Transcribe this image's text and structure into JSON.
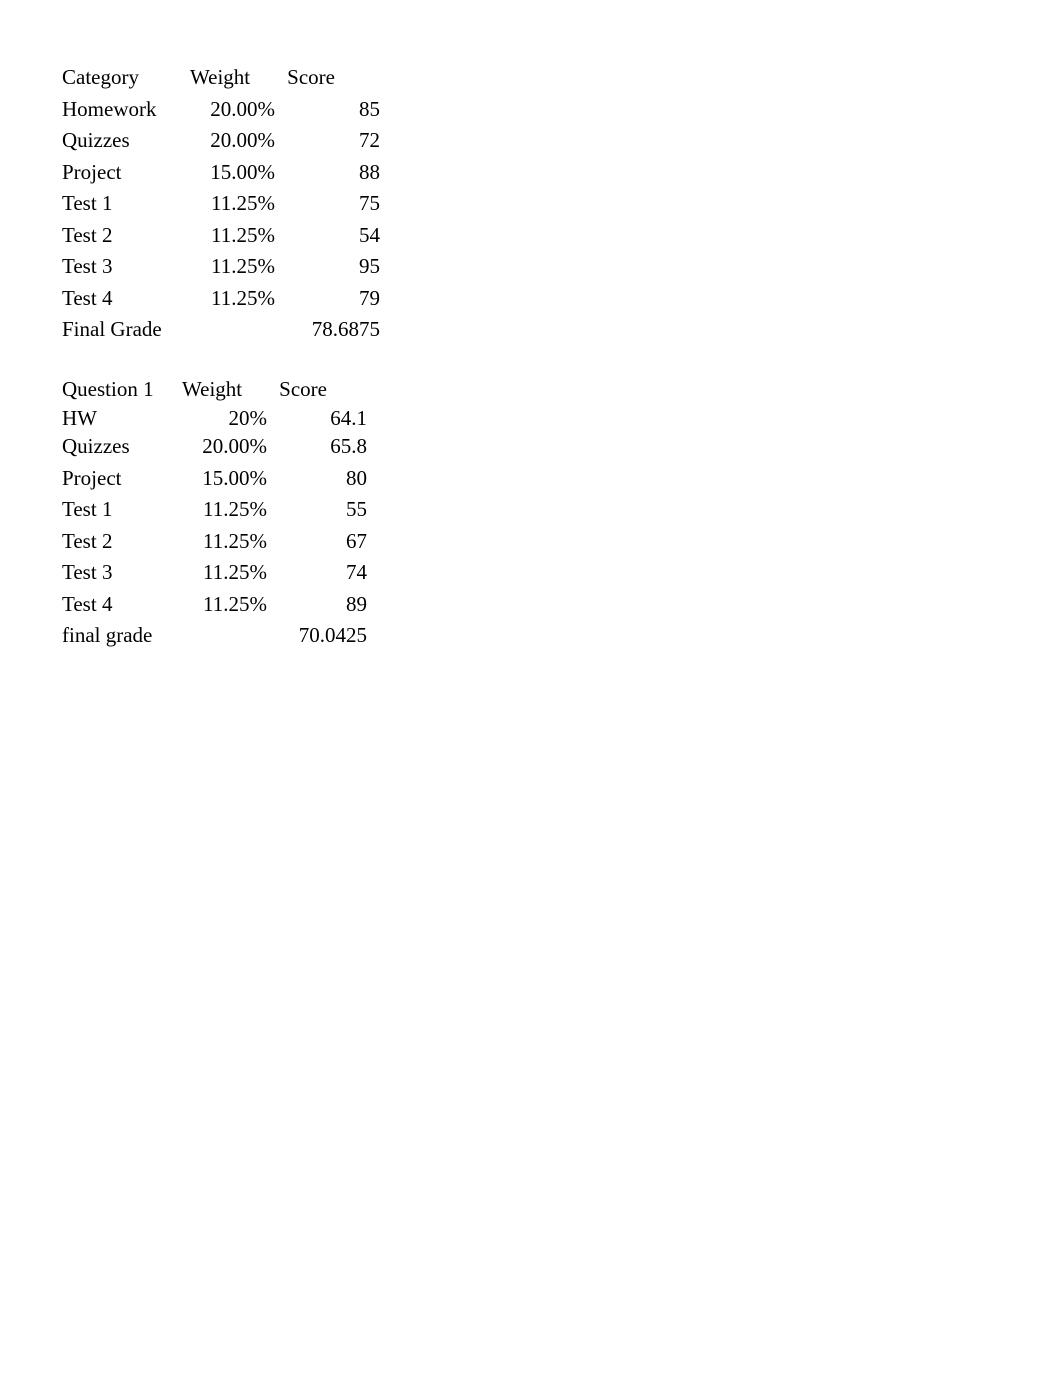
{
  "table1": {
    "headers": {
      "category": "Category",
      "weight": "Weight",
      "score": "Score"
    },
    "rows": [
      {
        "category": "Homework",
        "weight": "20.00%",
        "score": "85"
      },
      {
        "category": "Quizzes",
        "weight": "20.00%",
        "score": "72"
      },
      {
        "category": "Project",
        "weight": "15.00%",
        "score": "88"
      },
      {
        "category": "Test 1",
        "weight": "11.25%",
        "score": "75"
      },
      {
        "category": "Test 2",
        "weight": "11.25%",
        "score": "54"
      },
      {
        "category": "Test 3",
        "weight": "11.25%",
        "score": "95"
      },
      {
        "category": "Test 4",
        "weight": "11.25%",
        "score": "79"
      }
    ],
    "final": {
      "label": "Final Grade",
      "value": "78.6875"
    }
  },
  "table2": {
    "headers": {
      "category": "Question 1",
      "weight": "Weight",
      "score": "Score"
    },
    "rows": [
      {
        "category": "HW",
        "weight": "20%",
        "score": "64.1"
      },
      {
        "category": "Quizzes",
        "weight": "20.00%",
        "score": "65.8"
      },
      {
        "category": "Project",
        "weight": "15.00%",
        "score": "80"
      },
      {
        "category": "Test 1",
        "weight": "11.25%",
        "score": "55"
      },
      {
        "category": "Test 2",
        "weight": "11.25%",
        "score": "67"
      },
      {
        "category": "Test 3",
        "weight": "11.25%",
        "score": "74"
      },
      {
        "category": "Test 4",
        "weight": "11.25%",
        "score": "89"
      }
    ],
    "final": {
      "label": "final grade",
      "value": "70.0425"
    }
  }
}
